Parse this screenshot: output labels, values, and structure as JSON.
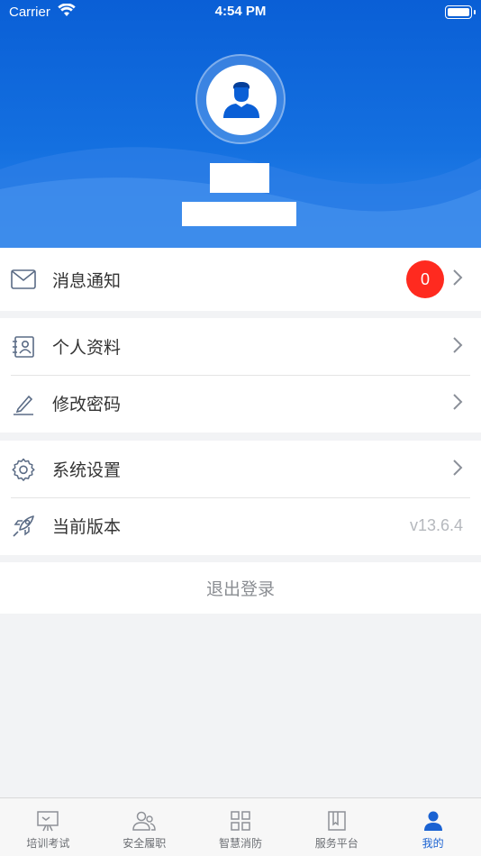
{
  "status_bar": {
    "carrier": "Carrier",
    "time": "4:54 PM"
  },
  "colors": {
    "brand": "#0a5fd6",
    "badge": "#ff2a1f",
    "active_tab": "#1a62d2"
  },
  "menu": {
    "notifications": {
      "label": "消息通知",
      "count": "0",
      "icon": "mail-icon"
    },
    "profile": {
      "label": "个人资料",
      "icon": "contact-card-icon"
    },
    "password": {
      "label": "修改密码",
      "icon": "pencil-icon"
    },
    "settings": {
      "label": "系统设置",
      "icon": "gear-icon"
    },
    "version": {
      "label": "当前版本",
      "value": "v13.6.4",
      "icon": "rocket-icon"
    }
  },
  "logout_label": "退出登录",
  "tabs": [
    {
      "label": "培训考试",
      "icon": "presentation-board-icon",
      "active": false
    },
    {
      "label": "安全履职",
      "icon": "users-icon",
      "active": false
    },
    {
      "label": "智慧消防",
      "icon": "grid-icon",
      "active": false
    },
    {
      "label": "服务平台",
      "icon": "book-icon",
      "active": false
    },
    {
      "label": "我的",
      "icon": "user-icon",
      "active": true
    }
  ]
}
